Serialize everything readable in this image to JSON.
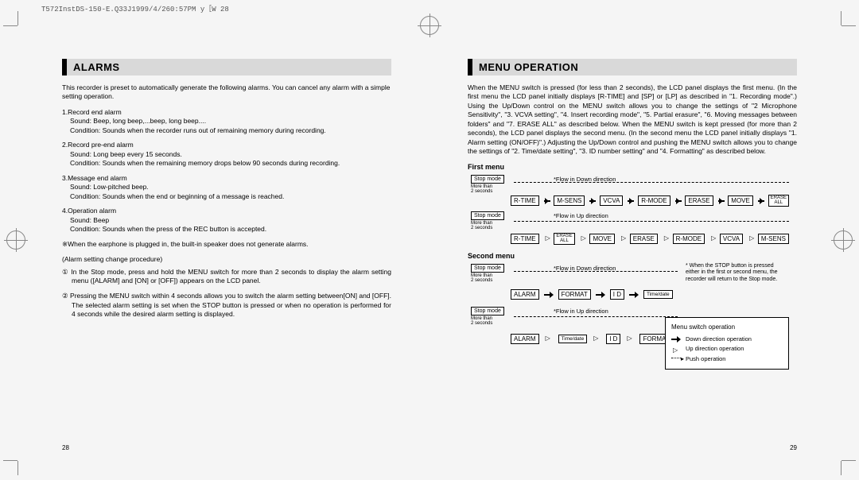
{
  "header_code": "T572InstDS-150-E.Q33J1999/4/260:57PM y［W 28",
  "left": {
    "title": "ALARMS",
    "intro": "This recorder is preset to automatically generate the following alarms. You can cancel any alarm with a simple setting operation.",
    "alarms": [
      {
        "num": "1.",
        "name": "Record end alarm",
        "sound": "Sound: Beep, long beep,...beep, long beep....",
        "cond": "Condition: Sounds when the recorder runs out of remaining memory during recording."
      },
      {
        "num": "2.",
        "name": "Record pre-end alarm",
        "sound": "Sound: Long beep every 15 seconds.",
        "cond": "Condition: Sounds when the remaining memory drops below 90 seconds during recording."
      },
      {
        "num": "3.",
        "name": "Message end alarm",
        "sound": "Sound: Low-pitched beep.",
        "cond": "Condition: Sounds when the end or beginning of a message is reached."
      },
      {
        "num": "4.",
        "name": "Operation alarm",
        "sound": "Sound: Beep",
        "cond": "Condition: Sounds when the press of the REC button is accepted."
      }
    ],
    "earphone_note": "※When the earphone is plugged in, the built-in speaker does not generate alarms.",
    "procedure_head": "(Alarm setting change procedure)",
    "procedure": [
      "① In the Stop mode, press and hold the MENU switch for more than 2 seconds to display the alarm setting menu ([ALARM] and [ON] or [OFF]) appears on the LCD panel.",
      "② Pressing the MENU switch within 4 seconds allows you to switch the alarm setting between[ON] and [OFF]. The selected alarm setting is set when the STOP button is pressed or when no operation is performed for 4 seconds while the desired alarm setting is displayed."
    ],
    "page": "28"
  },
  "right": {
    "title": "MENU OPERATION",
    "intro": "When the MENU switch is pressed (for less than 2 seconds), the LCD panel displays the first menu. (In the first menu the LCD panel initially displays [R-TIME] and [SP] or [LP] as described in \"1. Recording mode\".) Using the Up/Down control on the MENU switch allows you to change the settings of \"2 Microphone Sensitivity\", \"3. VCVA setting\", \"4. Insert recording mode\", \"5. Partial erasure\", \"6. Moving messages between folders\" and \"7. ERASE ALL\" as described below. When the MENU switch is kept pressed (for more than 2 seconds), the LCD panel displays the second menu. (In the second menu the LCD panel initially displays \"1. Alarm setting (ON/OFF)\".) Adjusting the Up/Down control and pushing the MENU switch allows you to change the settings of \"2. Time/date setting\", \"3. ID number setting\" and \"4. Formatting\" as described below.",
    "first_menu_label": "First menu",
    "second_menu_label": "Second menu",
    "stop_mode": "Stop mode",
    "more_than": "More than",
    "two_sec": "2 seconds",
    "flow_down": "*Flow in Down direction",
    "flow_up": "*Flow in Up direction",
    "row1": [
      "R-TIME",
      "M-SENS",
      "VCVA",
      "R-MODE",
      "ERASE",
      "MOVE",
      "ERASE ALL"
    ],
    "row2": [
      "R-TIME",
      "ERASE ALL",
      "MOVE",
      "ERASE",
      "R-MODE",
      "VCVA",
      "M-SENS"
    ],
    "row3": [
      "ALARM",
      "FORMAT",
      "I D",
      "Time/date"
    ],
    "row4": [
      "ALARM",
      "Time/date",
      "I D",
      "FORMAT"
    ],
    "stop_note": "* When the STOP button is pressed either in the first or second menu, the recorder will return to the Stop mode.",
    "legend": {
      "title": "Menu switch operation",
      "down": "Down direction operation",
      "up": "Up direction operation",
      "push": "Push operation"
    },
    "page": "29"
  }
}
